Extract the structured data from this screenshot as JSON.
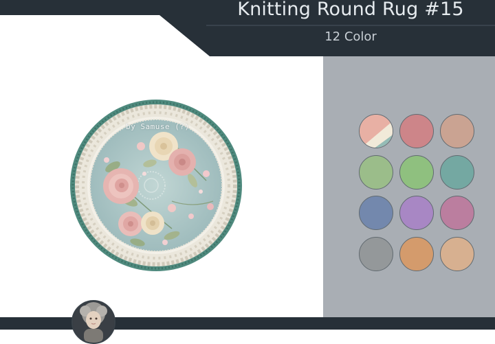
{
  "header": {
    "title": "Knitting Round Rug #15",
    "subtitle": "12 Color",
    "band_color": "#273038"
  },
  "preview": {
    "watermark": "by Samuse (?)",
    "rug_colors": {
      "border": "#4f8a7e",
      "lace": "#f2efe6",
      "field": "#a9c3c4",
      "rose_pink": "#e8b8b6",
      "rose_cream": "#efe2c8",
      "leaf": "#a3b38c"
    }
  },
  "swatches": [
    {
      "name": "multicolor",
      "colors": [
        "#e8b0a4",
        "#f1ead9",
        "#94bcb6"
      ]
    },
    {
      "name": "dusty-rose",
      "color": "#cd8589"
    },
    {
      "name": "tan",
      "color": "#caa392"
    },
    {
      "name": "sage",
      "color": "#9bbd8a"
    },
    {
      "name": "green",
      "color": "#8fc07f"
    },
    {
      "name": "teal",
      "color": "#74a8a2"
    },
    {
      "name": "blue",
      "color": "#7388ad"
    },
    {
      "name": "lavender",
      "color": "#a887c4"
    },
    {
      "name": "mauve",
      "color": "#bb7e9f"
    },
    {
      "name": "grey",
      "color": "#94989a"
    },
    {
      "name": "orange",
      "color": "#d49b6c"
    },
    {
      "name": "peach",
      "color": "#d7b090"
    }
  ],
  "footer": {
    "bar_color": "#273038",
    "avatar": "profile-avatar"
  }
}
